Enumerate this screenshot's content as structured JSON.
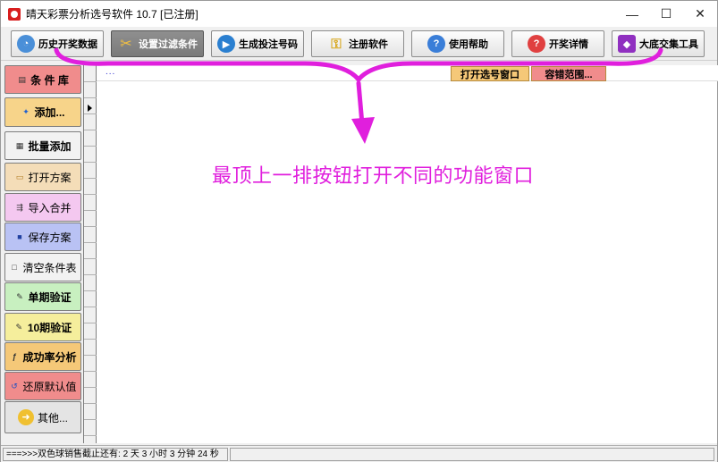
{
  "window": {
    "title": "晴天彩票分析选号软件 10.7  [已注册]",
    "controls": {
      "minimize": "—",
      "maximize": "☐",
      "close": "✕"
    }
  },
  "toolbar": {
    "buttons": [
      {
        "label": "历史开奖数据",
        "icon": "history-data-icon",
        "color": "#4a8fd8"
      },
      {
        "label": "设置过滤条件",
        "icon": "tools-icon",
        "color": "#e0a020"
      },
      {
        "label": "生成投注号码",
        "icon": "play-icon",
        "color": "#2a7fd0"
      },
      {
        "label": "注册软件",
        "icon": "key-icon",
        "color": "#e0b030"
      },
      {
        "label": "使用帮助",
        "icon": "help-icon",
        "color": "#3a7ed8"
      },
      {
        "label": "开奖详情",
        "icon": "lottery-detail-icon",
        "color": "#e04040"
      },
      {
        "label": "大底交集工具",
        "icon": "intersection-tool-icon",
        "color": "#9030c0"
      }
    ]
  },
  "sidebar": {
    "items": [
      {
        "label": "条 件 库",
        "icon": "condition-library-icon",
        "glyph": "▤",
        "bg": "#f08c8c"
      },
      {
        "label": "添加...",
        "icon": "add-icon",
        "glyph": "✦",
        "bg": "#f7d48a"
      },
      {
        "label": "批量添加",
        "icon": "batch-add-icon",
        "glyph": "▦",
        "bg": "#f2f2f2"
      },
      {
        "label": "打开方案",
        "icon": "open-folder-icon",
        "glyph": "▭",
        "bg": "#f4ddb8"
      },
      {
        "label": "导入合并",
        "icon": "import-merge-icon",
        "glyph": "⇶",
        "bg": "#f4c8f0"
      },
      {
        "label": "保存方案",
        "icon": "save-icon",
        "glyph": "■",
        "bg": "#b9c2f4"
      },
      {
        "label": "清空条件表",
        "icon": "clear-table-icon",
        "glyph": "□",
        "bg": "#f2f2f2"
      },
      {
        "label": "单期验证",
        "icon": "single-verify-icon",
        "glyph": "✎",
        "bg": "#c8f0c0"
      },
      {
        "label": "10期验证",
        "icon": "ten-verify-icon",
        "glyph": "✎",
        "bg": "#f5ee9c"
      },
      {
        "label": "成功率分析",
        "icon": "success-rate-icon",
        "glyph": "ƒ",
        "bg": "#f5c878"
      },
      {
        "label": "还原默认值",
        "icon": "restore-default-icon",
        "glyph": "↺",
        "bg": "#f08c8c"
      },
      {
        "label": "其他...",
        "icon": "more-arrow-icon",
        "glyph": "➜",
        "bg": "#e4e4e4"
      }
    ]
  },
  "grid": {
    "dots": "...",
    "open_window_label": "打开选号窗口",
    "tolerance_label": "容错范围..."
  },
  "annotation": {
    "text": "最顶上一排按钮打开不同的功能窗口",
    "color": "#e01fdd"
  },
  "status": {
    "text": "===>>>双色球销售截止还有: 2 天 3 小时 3 分钟 24 秒"
  }
}
